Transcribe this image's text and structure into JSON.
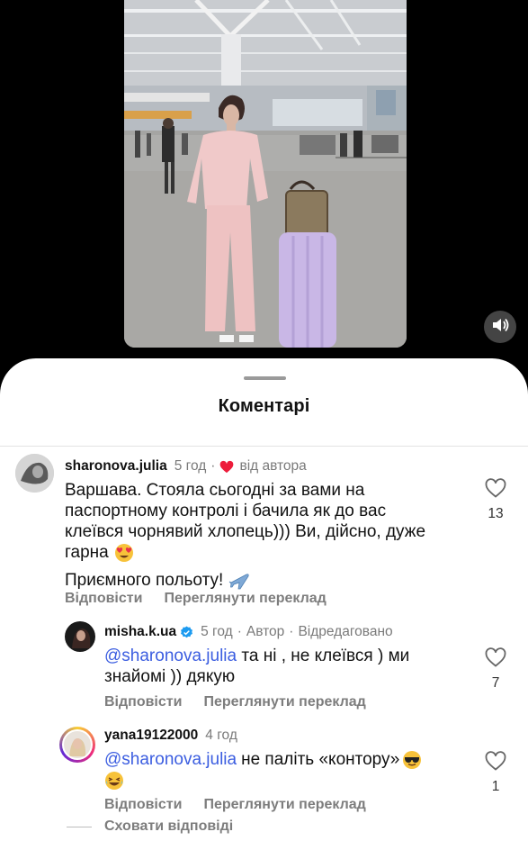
{
  "sheet": {
    "title": "Коментарі"
  },
  "comments": [
    {
      "username": "sharonova.julia",
      "time": "5 год",
      "author_badge": "від автора",
      "text_lines": [
        "Варшава. Стояла сьогодні за вами на",
        "паспортному контролі і бачила як до вас",
        "клеївся чорнявий хлопець))) Ви, дійсно, дуже",
        "гарна"
      ],
      "text_line2": "Приємного польоту!",
      "reply_label": "Відповісти",
      "translate_label": "Переглянути переклад",
      "likes": "13"
    },
    {
      "username": "misha.k.ua",
      "time": "5 год",
      "role": "Автор",
      "edited": "Відредаговано",
      "mention": "@sharonova.julia",
      "text_rest": "та ні , не клеївся ) ми",
      "text_line2": "знайомі )) дякую",
      "reply_label": "Відповісти",
      "translate_label": "Переглянути переклад",
      "likes": "7"
    },
    {
      "username": "yana19122000",
      "time": "4 год",
      "mention": "@sharonova.julia",
      "text_rest": "не паліть «контору»",
      "reply_label": "Відповісти",
      "translate_label": "Переглянути переклад",
      "likes": "1"
    }
  ],
  "hide_replies": "Сховати відповіді",
  "colors": {
    "heart_red": "#ed1c3b",
    "mention_blue": "#3b5de0",
    "verified_blue": "#1d9bf0"
  },
  "icons": [
    "mute-icon",
    "heart-outline-icon",
    "heart-filled-icon",
    "verified-icon",
    "heart-eyes-emoji",
    "airplane-emoji",
    "sunglasses-emoji",
    "laughing-emoji"
  ]
}
